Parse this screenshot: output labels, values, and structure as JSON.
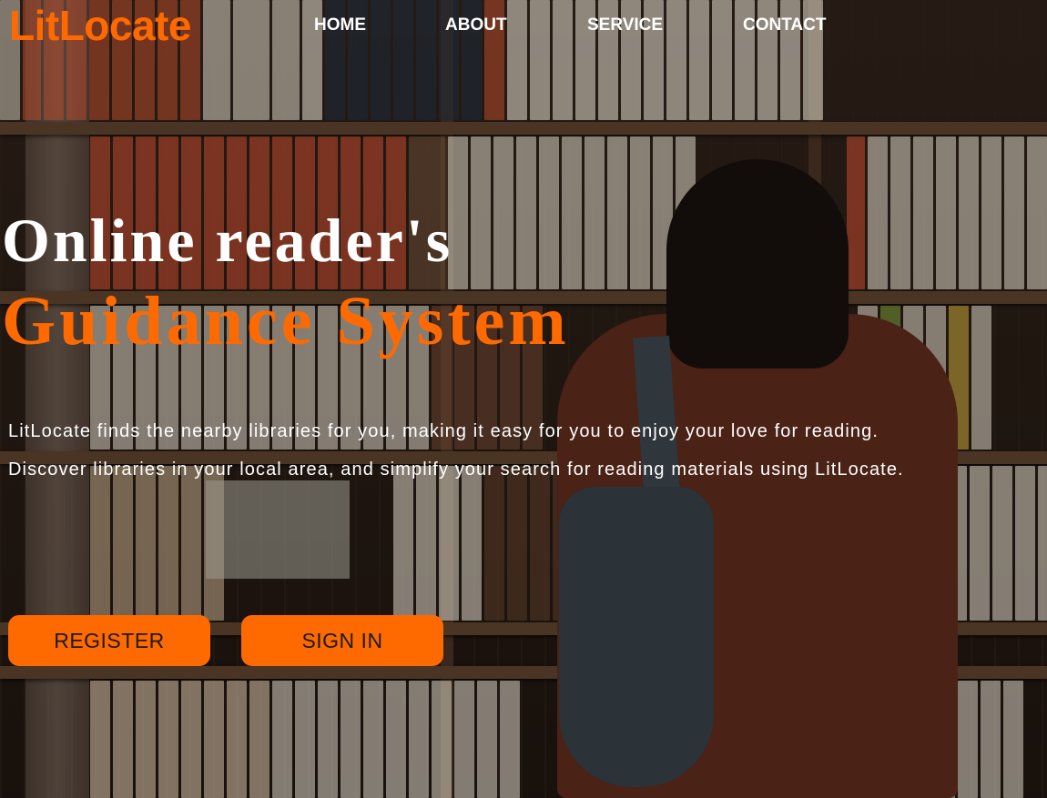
{
  "brand": {
    "name": "LitLocate",
    "accent_color": "#ff6a00"
  },
  "nav": {
    "items": [
      {
        "label": "HOME"
      },
      {
        "label": "ABOUT"
      },
      {
        "label": "SERVICE"
      },
      {
        "label": "CONTACT"
      }
    ]
  },
  "hero": {
    "title_line1": "Online reader's",
    "title_line2": "Guidance System",
    "description_line1": "LitLocate finds the nearby libraries for you, making it easy for you to enjoy your love for reading.",
    "description_line2": "Discover libraries in your local area, and simplify your search for reading materials using LitLocate.",
    "background_image": "bookshelf-photo"
  },
  "actions": {
    "register_label": "REGISTER",
    "signin_label": "SIGN IN"
  }
}
